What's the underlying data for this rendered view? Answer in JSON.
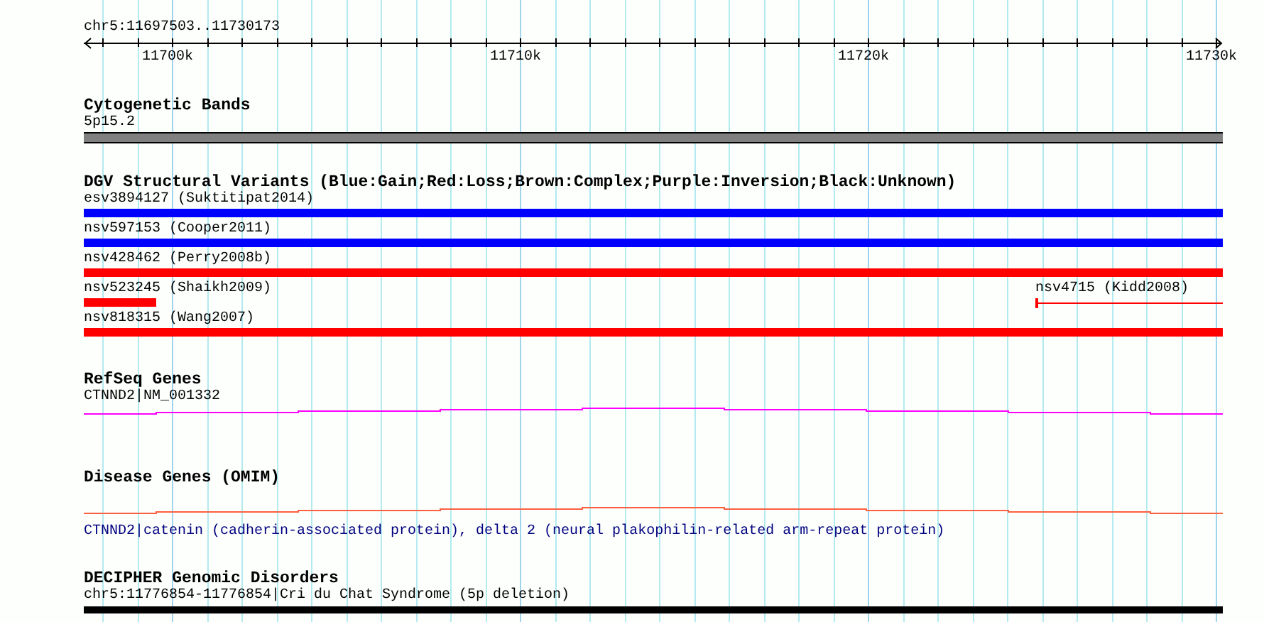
{
  "ruler": {
    "range": "chr5:11697503..11730173",
    "labels": [
      "11700k",
      "11710k",
      "11720k",
      "11730k"
    ]
  },
  "tracks": [
    {
      "kind": "bands",
      "title": "Cytogenetic Bands",
      "items": [
        {
          "label": "5p15.2"
        }
      ]
    },
    {
      "kind": "variants",
      "title": "DGV Structural Variants (Blue:Gain;Red:Loss;Brown:Complex;Purple:Inversion;Black:Unknown)",
      "rows": [
        {
          "items": [
            {
              "label": "esv3894127 (Suktitipat2014)",
              "kind": "full",
              "color": "#0000ff"
            }
          ]
        },
        {
          "items": [
            {
              "label": "nsv597153 (Cooper2011)",
              "kind": "full",
              "color": "#0000ff"
            }
          ]
        },
        {
          "items": [
            {
              "label": "nsv428462 (Perry2008b)",
              "kind": "full",
              "color": "#ff0000"
            }
          ]
        },
        {
          "items": [
            {
              "label": "nsv523245 (Shaikh2009)",
              "kind": "short",
              "color": "#ff0000"
            },
            {
              "label": "nsv4715 (Kidd2008)",
              "kind": "thin",
              "color": "#ff0000"
            }
          ]
        },
        {
          "items": [
            {
              "label": "nsv818315 (Wang2007)",
              "kind": "full",
              "color": "#ff0000"
            }
          ]
        }
      ]
    },
    {
      "kind": "gene",
      "title": "RefSeq Genes",
      "items": [
        {
          "label": "CTNND2|NM_001332"
        }
      ]
    },
    {
      "kind": "disease",
      "title": "Disease Genes (OMIM)",
      "items": [
        {
          "label": "CTNND2|catenin (cadherin-associated protein), delta 2 (neural plakophilin-related arm-repeat protein)"
        }
      ]
    },
    {
      "kind": "disorder",
      "title": "DECIPHER Genomic Disorders",
      "items": [
        {
          "label": "chr5:11776854-11776854|Cri du Chat Syndrome (5p deletion)"
        }
      ]
    }
  ]
}
